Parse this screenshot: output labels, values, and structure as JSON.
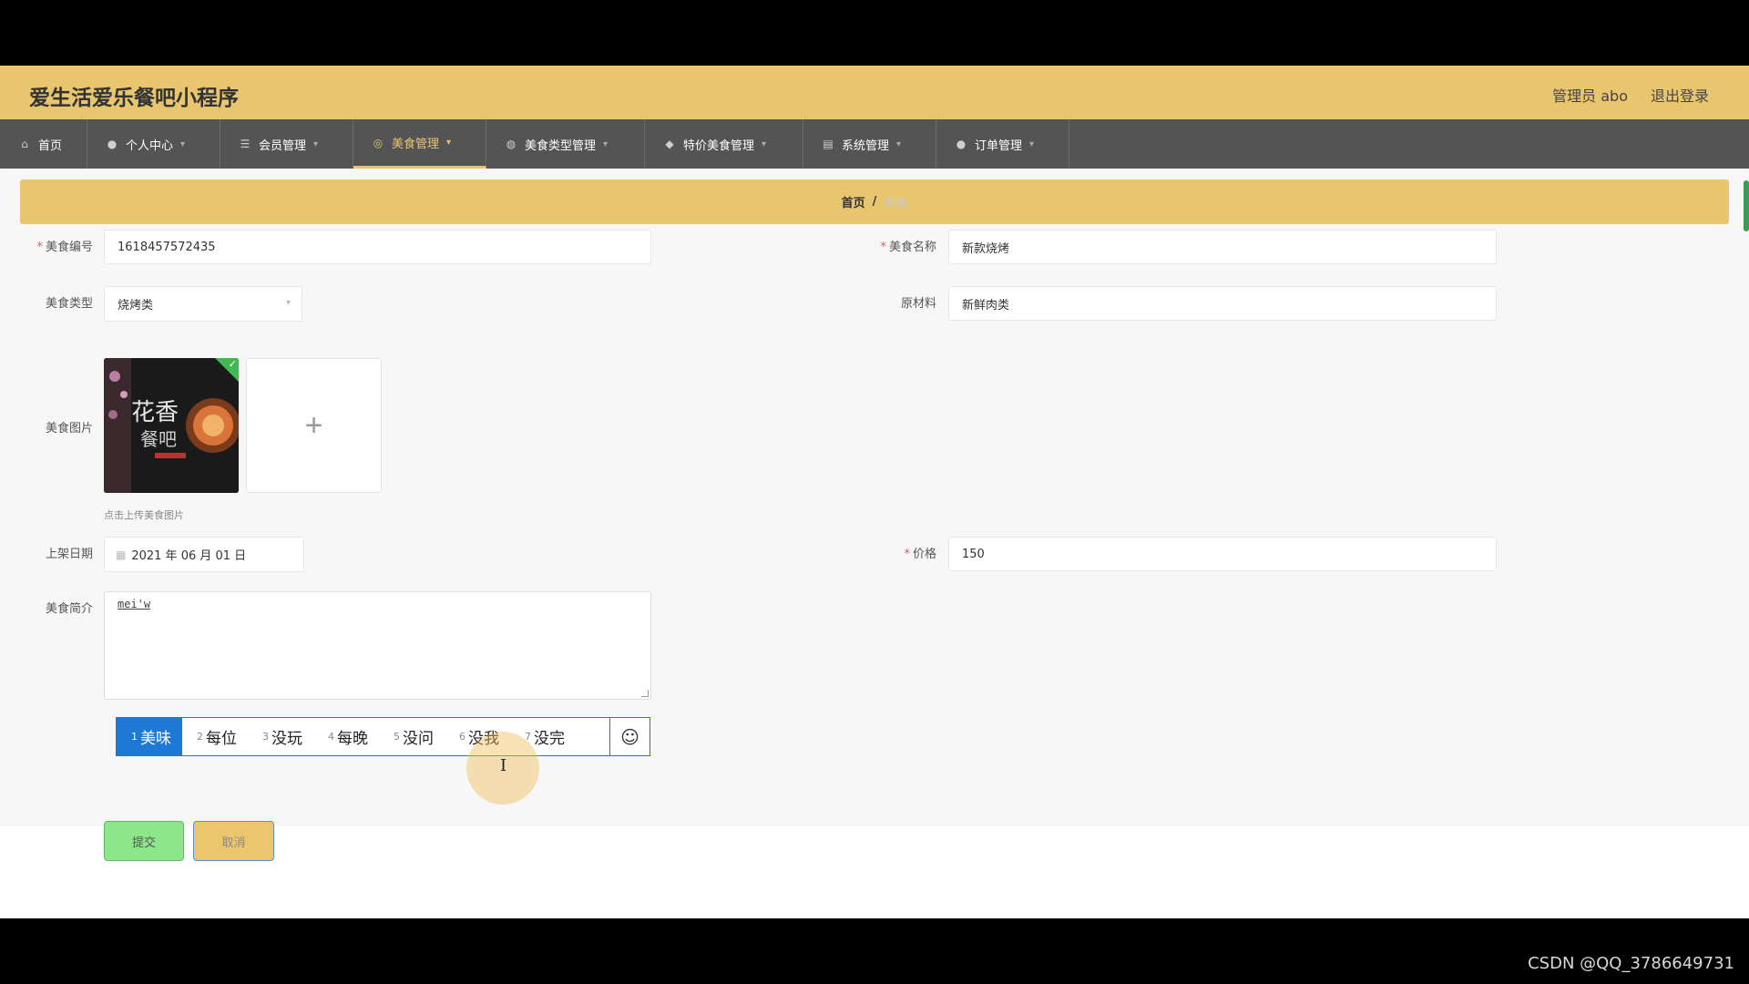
{
  "header": {
    "app_title": "爱生活爱乐餐吧小程序",
    "admin_label": "管理员 abo",
    "logout_label": "退出登录"
  },
  "nav": {
    "items": [
      {
        "label": "首页",
        "icon": "home-icon"
      },
      {
        "label": "个人中心",
        "icon": "user-icon"
      },
      {
        "label": "会员管理",
        "icon": "list-icon"
      },
      {
        "label": "美食管理",
        "icon": "compass-icon",
        "active": true
      },
      {
        "label": "美食类型管理",
        "icon": "globe-icon"
      },
      {
        "label": "特价美食管理",
        "icon": "tag-icon"
      },
      {
        "label": "系统管理",
        "icon": "settings-icon"
      },
      {
        "label": "订单管理",
        "icon": "user-icon"
      }
    ]
  },
  "breadcrumb": {
    "home": "首页",
    "separator": "/",
    "current": "美食"
  },
  "form": {
    "food_no": {
      "label": "美食编号",
      "required": true,
      "value": "1618457572435"
    },
    "food_name": {
      "label": "美食名称",
      "required": true,
      "value": "新款烧烤"
    },
    "food_type": {
      "label": "美食类型",
      "value": "烧烤类"
    },
    "ingredients": {
      "label": "原材料",
      "value": "新鲜肉类"
    },
    "image": {
      "label": "美食图片",
      "hint": "点击上传美食图片",
      "upload_symbol": "+"
    },
    "shelf_date": {
      "label": "上架日期",
      "value": "2021 年 06 月 01 日"
    },
    "price": {
      "label": "价格",
      "required": true,
      "value": "150"
    },
    "intro": {
      "label": "美食简介",
      "typed_text": "mei'w"
    }
  },
  "ime": {
    "candidates": [
      {
        "num": "1",
        "text": "美味"
      },
      {
        "num": "2",
        "text": "每位"
      },
      {
        "num": "3",
        "text": "没玩"
      },
      {
        "num": "4",
        "text": "每晚"
      },
      {
        "num": "5",
        "text": "没问"
      },
      {
        "num": "6",
        "text": "没我"
      },
      {
        "num": "7",
        "text": "没完"
      }
    ],
    "selected": 0,
    "emoji_icon": "smiley-icon"
  },
  "buttons": {
    "submit": "提交",
    "cancel": "取消"
  },
  "watermark": "CSDN @QQ_3786649731",
  "colors": {
    "header_bg": "#e8c56f",
    "nav_bg": "#545454",
    "accent": "#e8c56f",
    "submit_bg": "#8ee68a",
    "ime_selected": "#1e79d6"
  }
}
